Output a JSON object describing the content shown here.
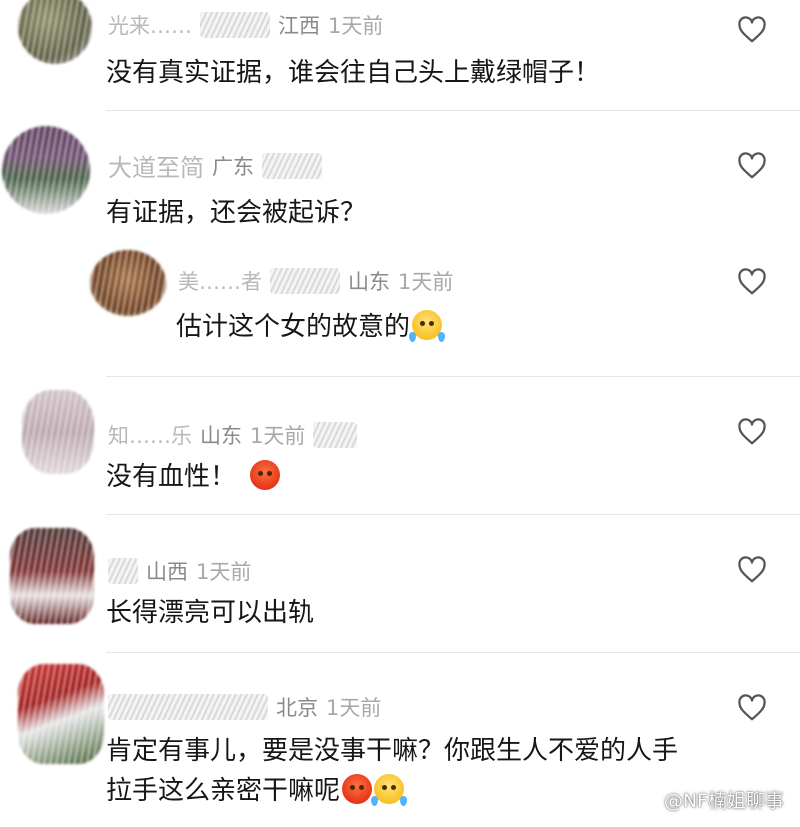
{
  "comments": [
    {
      "name": "光来……",
      "location": "江西",
      "time": "1天前",
      "text": "没有真实证据，谁会往自己头上戴绿帽子！"
    },
    {
      "name": "大道至简",
      "location": "广东",
      "time": "1天前",
      "text": "有证据，还会被起诉？"
    },
    {
      "name": "美……者",
      "location": "山东",
      "time": "1天前",
      "text": "估计这个女的故意的",
      "emoji": "cry-laugh-icon"
    },
    {
      "name": "知……乐",
      "location": "山东",
      "time": "1天前",
      "text": "没有血性！",
      "emoji": "angry-icon"
    },
    {
      "name": "",
      "location": "山西",
      "time": "1天前",
      "text": "长得漂亮可以出轨"
    },
    {
      "name": "",
      "location": "北京",
      "time": "1天前",
      "text_line1": "肯定有事儿，要是没事干嘛？你跟生人不爱的人手",
      "text_line2": "拉手这么亲密干嘛呢",
      "emojis": [
        "angry-icon",
        "cry-laugh-icon"
      ]
    }
  ],
  "watermark": "@NF楠姐聊事",
  "colors": {
    "text": "#161616",
    "meta": "#a9a9a9",
    "divider": "#e6e6e6",
    "heart": "#555555"
  }
}
